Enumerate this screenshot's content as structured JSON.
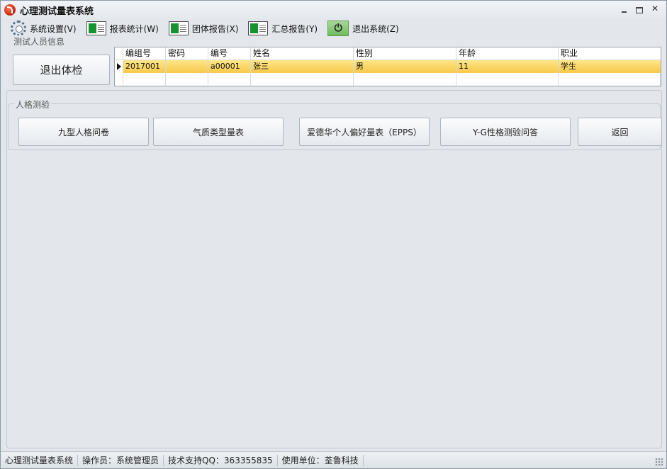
{
  "window": {
    "title": "心理测试量表系统"
  },
  "menu": [
    {
      "label": "系统设置(V)",
      "icon": "gear-icon"
    },
    {
      "label": "报表统计(W)",
      "icon": "report-icon"
    },
    {
      "label": "团体报告(X)",
      "icon": "report-icon"
    },
    {
      "label": "汇总报告(Y)",
      "icon": "report-icon"
    },
    {
      "label": "退出系统(Z)",
      "icon": "power-icon"
    }
  ],
  "tester_group": {
    "legend": "测试人员信息",
    "exit_button": "退出体检",
    "columns": [
      "编组号",
      "密码",
      "编号",
      "姓名",
      "性别",
      "年龄",
      "职业"
    ],
    "rows": [
      [
        "2017001",
        "",
        "a00001",
        "张三",
        "男",
        "11",
        "学生"
      ]
    ]
  },
  "personality_group": {
    "legend": "人格测验",
    "buttons": [
      "九型人格问卷",
      "气质类型量表",
      "爱德华个人偏好量表（EPPS）",
      "Y-G性格测验问答",
      "返回"
    ]
  },
  "status": {
    "app": "心理测试量表系统",
    "operator": "操作员：系统管理员",
    "support": "技术支持QQ：363355835",
    "unit": "使用单位：荃鲁科技"
  },
  "colors": {
    "selected_row": "#f7c84a",
    "window_bg": "#e3e7eb"
  }
}
